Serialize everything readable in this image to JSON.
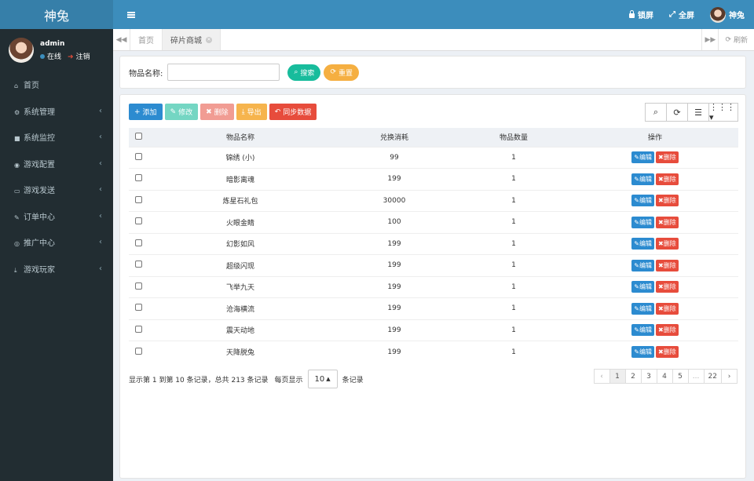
{
  "app": {
    "logo": "神兔"
  },
  "header": {
    "lock": "锁屏",
    "fullscreen": "全屏",
    "username": "神兔"
  },
  "sidebar": {
    "user": {
      "name": "admin",
      "status": "在线",
      "logout": "注销"
    },
    "items": [
      {
        "label": "首页",
        "icon": "home-icon",
        "glyph": "⌂",
        "expandable": false
      },
      {
        "label": "系统管理",
        "icon": "gear-icon",
        "glyph": "⚙",
        "expandable": true
      },
      {
        "label": "系统监控",
        "icon": "video-icon",
        "glyph": "■",
        "expandable": true
      },
      {
        "label": "游戏配置",
        "icon": "dashboard-icon",
        "glyph": "◉",
        "expandable": true
      },
      {
        "label": "游戏发送",
        "icon": "keyboard-icon",
        "glyph": "▭",
        "expandable": true
      },
      {
        "label": "订单中心",
        "icon": "paint-brush-icon",
        "glyph": "✎",
        "expandable": true
      },
      {
        "label": "推广中心",
        "icon": "eye-icon",
        "glyph": "◎",
        "expandable": true
      },
      {
        "label": "游戏玩家",
        "icon": "download-icon",
        "glyph": "⤓",
        "expandable": true
      }
    ]
  },
  "tabs": {
    "items": [
      "首页",
      "碎片商城"
    ],
    "active": 1,
    "refresh": "刷新"
  },
  "search": {
    "label": "物品名称:",
    "value": "",
    "placeholder": "",
    "search_btn": "搜索",
    "reset_btn": "重置"
  },
  "toolbar": {
    "add": "添加",
    "edit": "修改",
    "delete": "删除",
    "export": "导出",
    "sync": "同步数据"
  },
  "table": {
    "headers": [
      "物品名称",
      "兑换消耗",
      "物品数量",
      "操作"
    ],
    "edit_label": "编辑",
    "delete_label": "删除",
    "rows": [
      {
        "name": "锦绣 (小)",
        "cost": "99",
        "qty": "1"
      },
      {
        "name": "暗影离魂",
        "cost": "199",
        "qty": "1"
      },
      {
        "name": "炼星石礼包",
        "cost": "30000",
        "qty": "1"
      },
      {
        "name": "火眼金睛",
        "cost": "100",
        "qty": "1"
      },
      {
        "name": "幻影如风",
        "cost": "199",
        "qty": "1"
      },
      {
        "name": "超级闪现",
        "cost": "199",
        "qty": "1"
      },
      {
        "name": "飞举九天",
        "cost": "199",
        "qty": "1"
      },
      {
        "name": "沧海横流",
        "cost": "199",
        "qty": "1"
      },
      {
        "name": "震天动地",
        "cost": "199",
        "qty": "1"
      },
      {
        "name": "天降脱兔",
        "cost": "199",
        "qty": "1"
      }
    ]
  },
  "pagination": {
    "info": "显示第 1 到第 10 条记录，总共 213 条记录",
    "per_page_prefix": "每页显示",
    "per_page": "10",
    "per_page_suffix": "条记录",
    "prev": "‹",
    "pages": [
      "1",
      "2",
      "3",
      "4",
      "5",
      "...",
      "22"
    ],
    "active_page": "1",
    "next": "›"
  }
}
